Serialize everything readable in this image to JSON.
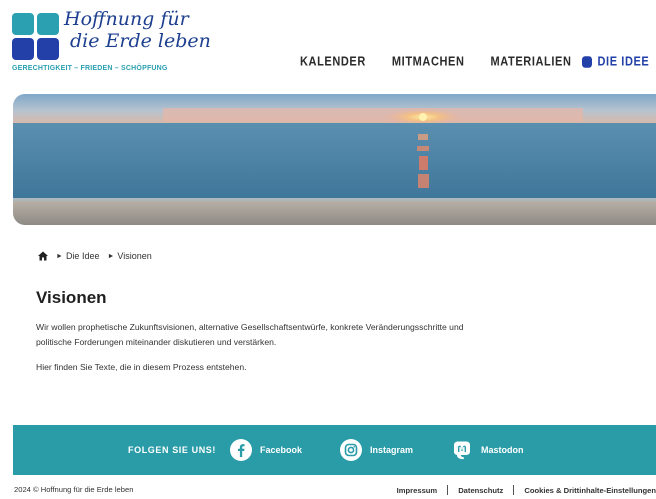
{
  "logo": {
    "line1": "Hoffnung für",
    "line2": "die Erde leben",
    "tagline": "GERECHTIGKEIT – FRIEDEN – SCHÖPFUNG",
    "colors": [
      "#2aa0b0",
      "#2aa0b0",
      "#2340a8",
      "#2340a8"
    ]
  },
  "nav": {
    "items": [
      {
        "label": "KALENDER"
      },
      {
        "label": "MITMACHEN"
      },
      {
        "label": "MATERIALIEN"
      }
    ],
    "active": {
      "label": "DIE IDEE"
    }
  },
  "hero": {
    "image_description_icon": "sunset-sea-image"
  },
  "breadcrumb": {
    "home_icon": "home-icon",
    "items": [
      "Die Idee",
      "Visionen"
    ]
  },
  "main": {
    "title": "Visionen",
    "paragraph1_line1": "Wir wollen prophetische Zukunftsvisionen, alternative Gesellschaftsentwürfe, konkrete Veränderungsschritte und",
    "paragraph1_line2": "politische Forderungen miteinander diskutieren und verstärken.",
    "paragraph2": "Hier finden Sie Texte, die in diesem Prozess entstehen."
  },
  "follow": {
    "label": "FOLGEN SIE UNS!",
    "facebook": "Facebook",
    "instagram": "Instagram",
    "mastodon": "Mastodon",
    "bar_color": "#2a9ca8"
  },
  "footer": {
    "copyright": "2024 © Hoffnung für die Erde leben",
    "links": [
      "Impressum",
      "Datenschutz",
      "Cookies & Drittinhalte-Einstellungen"
    ]
  }
}
